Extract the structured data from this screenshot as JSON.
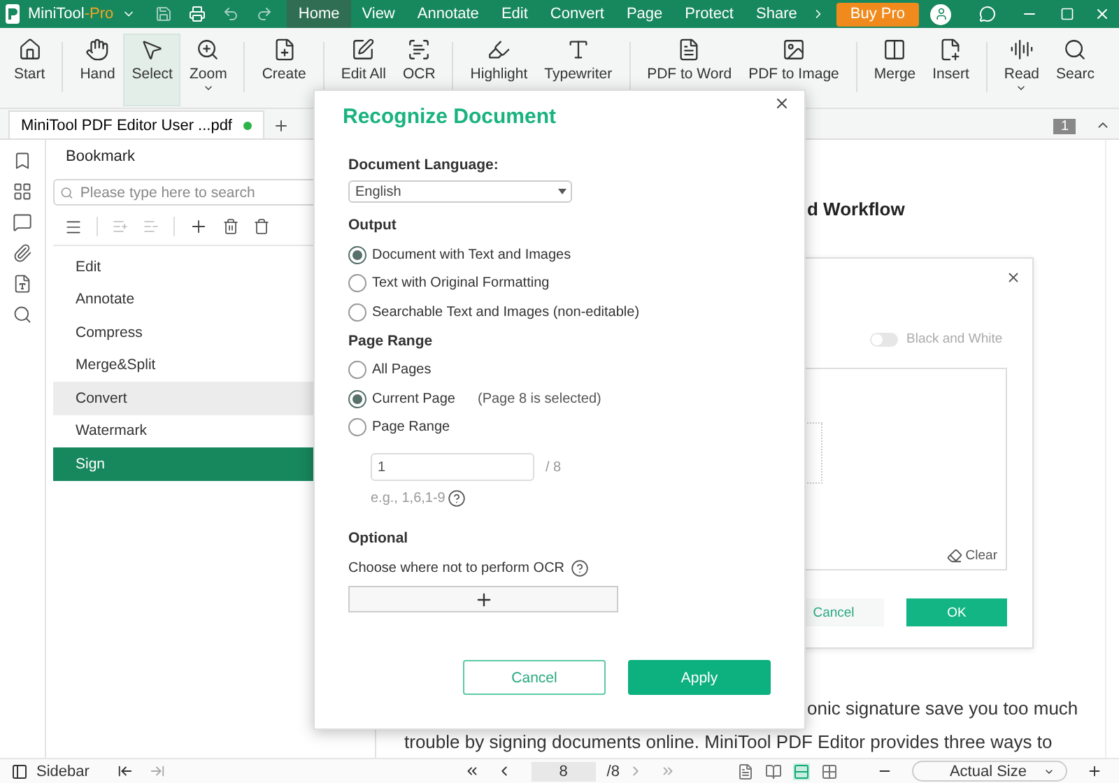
{
  "app": {
    "name": "MiniTool",
    "edition": "-Pro"
  },
  "menu_tabs": [
    {
      "label": "Home",
      "selected": true
    },
    {
      "label": "View",
      "selected": false
    },
    {
      "label": "Annotate",
      "selected": false
    },
    {
      "label": "Edit",
      "selected": false
    },
    {
      "label": "Convert",
      "selected": false
    },
    {
      "label": "Page",
      "selected": false
    },
    {
      "label": "Protect",
      "selected": false
    },
    {
      "label": "Share",
      "selected": false
    }
  ],
  "buy_button": "Buy Pro",
  "ribbon": [
    {
      "label": "Start",
      "selected": false,
      "dropdown": false
    },
    {
      "label": "Hand",
      "selected": false,
      "dropdown": false
    },
    {
      "label": "Select",
      "selected": true,
      "dropdown": false
    },
    {
      "label": "Zoom",
      "selected": false,
      "dropdown": true
    },
    {
      "label": "Create",
      "selected": false,
      "dropdown": false
    },
    {
      "label": "Edit All",
      "selected": false,
      "dropdown": false
    },
    {
      "label": "OCR",
      "selected": false,
      "dropdown": false
    },
    {
      "label": "Highlight",
      "selected": false,
      "dropdown": false
    },
    {
      "label": "Typewriter",
      "selected": false,
      "dropdown": false
    },
    {
      "label": "PDF to Word",
      "selected": false,
      "dropdown": false
    },
    {
      "label": "PDF to Image",
      "selected": false,
      "dropdown": false
    },
    {
      "label": "Merge",
      "selected": false,
      "dropdown": false
    },
    {
      "label": "Insert",
      "selected": false,
      "dropdown": false
    },
    {
      "label": "Read",
      "selected": false,
      "dropdown": true
    },
    {
      "label": "Searc",
      "selected": false,
      "dropdown": false
    }
  ],
  "doc_tab": {
    "title": "MiniTool PDF Editor User ...pdf",
    "unsaved": true
  },
  "page_badge": "1",
  "sidebar": {
    "title": "Bookmark",
    "search": {
      "placeholder": "Please type here to search"
    },
    "items": [
      {
        "label": "Edit",
        "selected": false,
        "hovered": false
      },
      {
        "label": "Annotate",
        "selected": false,
        "hovered": false
      },
      {
        "label": "Compress",
        "selected": false,
        "hovered": false
      },
      {
        "label": "Merge&Split",
        "selected": false,
        "hovered": false
      },
      {
        "label": "Convert",
        "selected": false,
        "hovered": true
      },
      {
        "label": "Watermark",
        "selected": false,
        "hovered": false
      },
      {
        "label": "Sign",
        "selected": true,
        "hovered": false
      }
    ]
  },
  "document": {
    "heading": "d Workflow",
    "signature_dialog": {
      "toggle": {
        "label": "Black and White",
        "on": false
      },
      "clear": "Clear",
      "cancel": "Cancel",
      "ok": "OK"
    },
    "lines": [
      "onic signature save you too much",
      "trouble by signing documents online. MiniTool PDF Editor provides three ways to"
    ]
  },
  "dialog": {
    "title": "Recognize Document",
    "language": {
      "label": "Document Language:",
      "value": "English"
    },
    "output": {
      "title": "Output",
      "options": [
        {
          "label": "Document with Text and Images",
          "selected": true
        },
        {
          "label": "Text with Original Formatting",
          "selected": false
        },
        {
          "label": "Searchable Text and Images (non-editable)",
          "selected": false
        }
      ]
    },
    "page_range": {
      "title": "Page Range",
      "options": [
        {
          "label": "All Pages",
          "selected": false
        },
        {
          "label": "Current Page",
          "note": "(Page 8 is selected)",
          "selected": true
        },
        {
          "label": "Page Range",
          "selected": false
        }
      ],
      "range_input": {
        "value": "1",
        "total": "/ 8",
        "hint": "e.g., 1,6,1-9"
      }
    },
    "optional": {
      "title": "Optional",
      "description": "Choose where not to perform OCR"
    },
    "cancel": "Cancel",
    "apply": "Apply"
  },
  "status_bar": {
    "sidebar_label": "Sidebar",
    "page": "8",
    "total": "/8",
    "zoom": "Actual Size",
    "view_modes": [
      {
        "selected": false
      },
      {
        "selected": false
      },
      {
        "selected": true
      },
      {
        "selected": false
      }
    ]
  }
}
